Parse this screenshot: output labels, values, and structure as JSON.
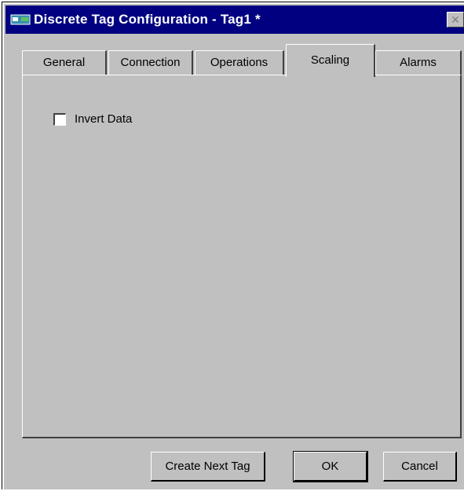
{
  "window": {
    "title": "Discrete Tag Configuration - Tag1 *",
    "close_glyph": "✕",
    "titlebar_color": "#000080",
    "face_color": "#c0c0c0"
  },
  "tabs": [
    {
      "label": "General",
      "active": false
    },
    {
      "label": "Connection",
      "active": false
    },
    {
      "label": "Operations",
      "active": false
    },
    {
      "label": "Scaling",
      "active": true
    },
    {
      "label": "Alarms",
      "active": false
    }
  ],
  "scaling": {
    "invert_data": {
      "label": "Invert Data",
      "checked": false
    }
  },
  "buttons": {
    "create_next": "Create Next Tag",
    "ok": "OK",
    "cancel": "Cancel"
  }
}
